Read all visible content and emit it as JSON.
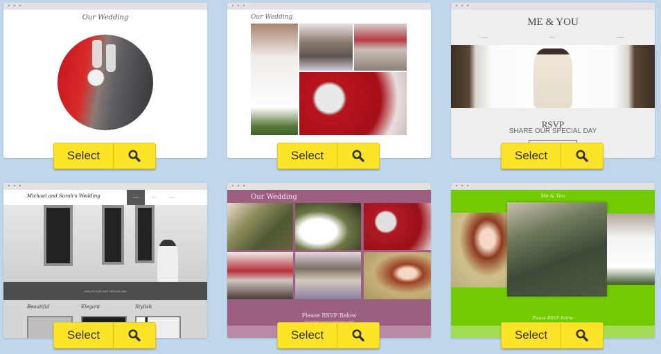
{
  "colors": {
    "page_background": "#c0d6ea",
    "button_yellow": "#fde429",
    "button_text": "#333333"
  },
  "templates": [
    {
      "name": "circle-photo-wedding",
      "title": "Our Wedding",
      "select_label": "Select",
      "preview_icon": "magnifier-icon"
    },
    {
      "name": "collage-wedding",
      "title": "Our Wedding",
      "select_label": "Select",
      "preview_icon": "magnifier-icon"
    },
    {
      "name": "me-and-you",
      "title": "ME & YOU",
      "nav": [
        "Home",
        "About",
        "Contact"
      ],
      "rsvp_heading": "RSVP",
      "rsvp_subheading": "SHARE OUR SPECIAL DAY",
      "select_label": "Select",
      "preview_icon": "magnifier-icon"
    },
    {
      "name": "black-white-wedding",
      "title": "Michael and Sarah's Wedding",
      "nav": [
        "Home",
        "About",
        "Contact"
      ],
      "banner_text": "JOIN US FOR OUR SPECIAL DAY",
      "features": [
        "Beautiful",
        "Elegant",
        "Stylish"
      ],
      "select_label": "Select",
      "preview_icon": "magnifier-icon"
    },
    {
      "name": "mauve-gallery-wedding",
      "title": "Our Wedding",
      "footer_heading": "Please RSVP Below",
      "footer_subtext": "We look forward to seeing you at this joyous occasion",
      "select_label": "Select",
      "preview_icon": "magnifier-icon"
    },
    {
      "name": "green-carousel-wedding",
      "title": "Me & You",
      "footer_heading": "Please RSVP Below",
      "select_label": "Select",
      "preview_icon": "magnifier-icon"
    }
  ]
}
